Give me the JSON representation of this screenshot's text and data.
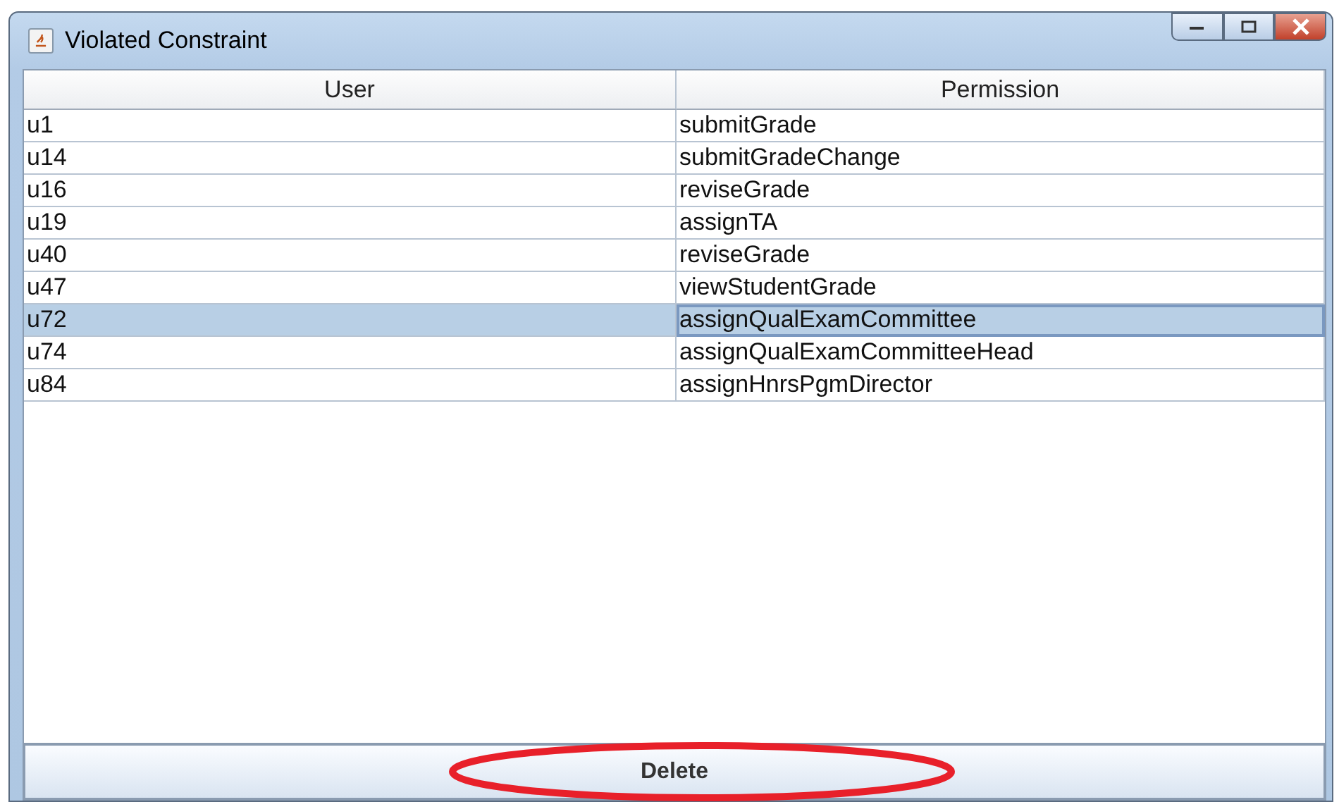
{
  "window": {
    "title": "Violated Constraint"
  },
  "table": {
    "columns": [
      "User",
      "Permission"
    ],
    "rows": [
      {
        "cells": [
          "u1",
          "submitGrade"
        ],
        "selected": false
      },
      {
        "cells": [
          "u14",
          "submitGradeChange"
        ],
        "selected": false
      },
      {
        "cells": [
          "u16",
          "reviseGrade"
        ],
        "selected": false
      },
      {
        "cells": [
          "u19",
          "assignTA"
        ],
        "selected": false
      },
      {
        "cells": [
          "u40",
          "reviseGrade"
        ],
        "selected": false
      },
      {
        "cells": [
          "u47",
          "viewStudentGrade"
        ],
        "selected": false
      },
      {
        "cells": [
          "u72",
          "assignQualExamCommittee"
        ],
        "selected": true
      },
      {
        "cells": [
          "u74",
          "assignQualExamCommitteeHead"
        ],
        "selected": false
      },
      {
        "cells": [
          "u84",
          "assignHnrsPgmDirector"
        ],
        "selected": false
      }
    ]
  },
  "buttons": [
    {
      "label": "Delete",
      "highlighted": true
    }
  ]
}
